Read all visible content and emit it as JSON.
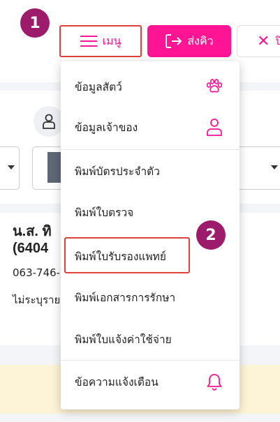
{
  "header": {
    "menu_label": "เมนู",
    "queue_label": "ส่งคิว",
    "close_label": "ปิ"
  },
  "callouts": [
    "1",
    "2"
  ],
  "patient": {
    "name_line1": "น.ส. ทิ",
    "name_line2": "(6404",
    "phone": "063-746-",
    "note": "ไม่ระบุราย"
  },
  "menu": {
    "items": [
      {
        "label": "ข้อมูลสัตว์",
        "icon": "paw-icon"
      },
      {
        "label": "ข้อมูลเจ้าของ",
        "icon": "person-icon"
      },
      {
        "label": "พิมพ์บัตรประจำตัว"
      },
      {
        "label": "พิมพ์ใบตรวจ"
      },
      {
        "label": "พิมพ์ใบรับรองแพทย์"
      },
      {
        "label": "พิมพ์เอกสารการรักษา"
      },
      {
        "label": "พิมพ์ใบแจ้งค่าใช้จ่าย"
      },
      {
        "label": "ข้อความแจ้งเตือน",
        "icon": "bell-icon"
      }
    ]
  },
  "colors": {
    "accent": "#ff1493",
    "highlight_border": "#e0413a",
    "callout": "#9c1b6a"
  }
}
